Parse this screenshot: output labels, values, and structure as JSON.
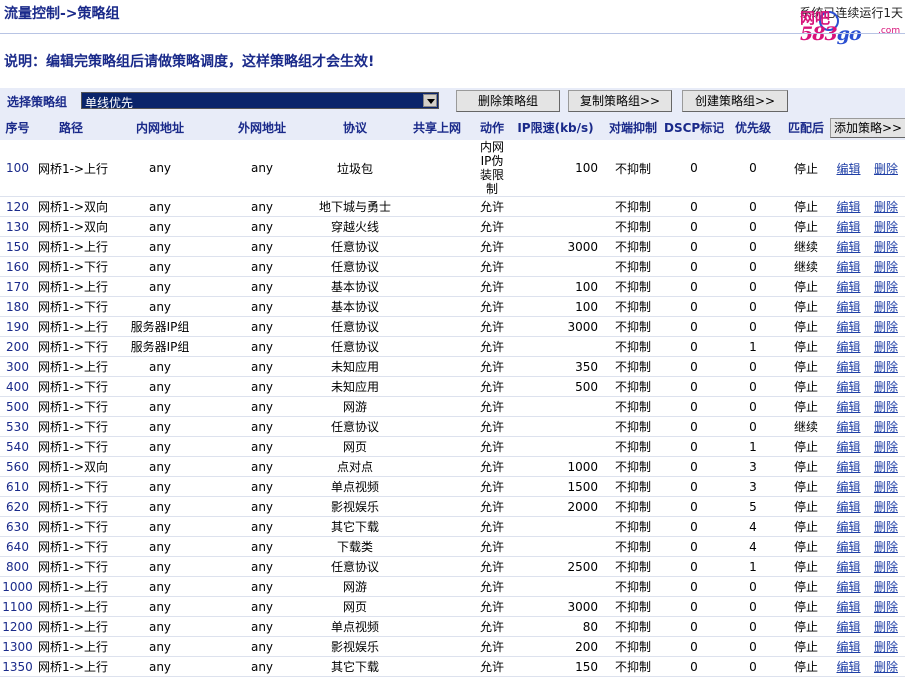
{
  "header": {
    "title": "流量控制->策略组",
    "right_text": "系统已连续运行1天"
  },
  "logo": {
    "line1": "网吧",
    "line2a": "583",
    "line2b": "go",
    "line3": ".com"
  },
  "note": "说明：编辑完策略组后请做策略调度，这样策略组才会生效!",
  "select": {
    "label": "选择策略组",
    "value": "单线优先",
    "delete_label": "删除策略组",
    "copy_label": "复制策略组>>",
    "create_label": "创建策略组>>"
  },
  "columns": [
    "序号",
    "路径",
    "内网地址",
    "外网地址",
    "协议",
    "共享上网",
    "动作",
    "IP限速(kb/s)",
    "对端抑制",
    "DSCP标记",
    "优先级",
    "匹配后"
  ],
  "add_label": "添加策略>>",
  "edit_label": "编辑",
  "delete_label": "删除",
  "rows": [
    [
      "100",
      "网桥1->上行",
      "any",
      "any",
      "垃圾包",
      "",
      "内网IP伪装限制",
      "100",
      "不抑制",
      "0",
      "0",
      "停止"
    ],
    [
      "120",
      "网桥1->双向",
      "any",
      "any",
      "地下城与勇士",
      "",
      "允许",
      "",
      "不抑制",
      "0",
      "0",
      "停止"
    ],
    [
      "130",
      "网桥1->双向",
      "any",
      "any",
      "穿越火线",
      "",
      "允许",
      "",
      "不抑制",
      "0",
      "0",
      "停止"
    ],
    [
      "150",
      "网桥1->上行",
      "any",
      "any",
      "任意协议",
      "",
      "允许",
      "3000",
      "不抑制",
      "0",
      "0",
      "继续"
    ],
    [
      "160",
      "网桥1->下行",
      "any",
      "any",
      "任意协议",
      "",
      "允许",
      "",
      "不抑制",
      "0",
      "0",
      "继续"
    ],
    [
      "170",
      "网桥1->上行",
      "any",
      "any",
      "基本协议",
      "",
      "允许",
      "100",
      "不抑制",
      "0",
      "0",
      "停止"
    ],
    [
      "180",
      "网桥1->下行",
      "any",
      "any",
      "基本协议",
      "",
      "允许",
      "100",
      "不抑制",
      "0",
      "0",
      "停止"
    ],
    [
      "190",
      "网桥1->上行",
      "服务器IP组",
      "any",
      "任意协议",
      "",
      "允许",
      "3000",
      "不抑制",
      "0",
      "0",
      "停止"
    ],
    [
      "200",
      "网桥1->下行",
      "服务器IP组",
      "any",
      "任意协议",
      "",
      "允许",
      "",
      "不抑制",
      "0",
      "1",
      "停止"
    ],
    [
      "300",
      "网桥1->上行",
      "any",
      "any",
      "未知应用",
      "",
      "允许",
      "350",
      "不抑制",
      "0",
      "0",
      "停止"
    ],
    [
      "400",
      "网桥1->下行",
      "any",
      "any",
      "未知应用",
      "",
      "允许",
      "500",
      "不抑制",
      "0",
      "0",
      "停止"
    ],
    [
      "500",
      "网桥1->下行",
      "any",
      "any",
      "网游",
      "",
      "允许",
      "",
      "不抑制",
      "0",
      "0",
      "停止"
    ],
    [
      "530",
      "网桥1->下行",
      "any",
      "any",
      "任意协议",
      "",
      "允许",
      "",
      "不抑制",
      "0",
      "0",
      "继续"
    ],
    [
      "540",
      "网桥1->下行",
      "any",
      "any",
      "网页",
      "",
      "允许",
      "",
      "不抑制",
      "0",
      "1",
      "停止"
    ],
    [
      "560",
      "网桥1->双向",
      "any",
      "any",
      "点对点",
      "",
      "允许",
      "1000",
      "不抑制",
      "0",
      "3",
      "停止"
    ],
    [
      "610",
      "网桥1->下行",
      "any",
      "any",
      "单点视频",
      "",
      "允许",
      "1500",
      "不抑制",
      "0",
      "3",
      "停止"
    ],
    [
      "620",
      "网桥1->下行",
      "any",
      "any",
      "影视娱乐",
      "",
      "允许",
      "2000",
      "不抑制",
      "0",
      "5",
      "停止"
    ],
    [
      "630",
      "网桥1->下行",
      "any",
      "any",
      "其它下载",
      "",
      "允许",
      "",
      "不抑制",
      "0",
      "4",
      "停止"
    ],
    [
      "640",
      "网桥1->下行",
      "any",
      "any",
      "下载类",
      "",
      "允许",
      "",
      "不抑制",
      "0",
      "4",
      "停止"
    ],
    [
      "800",
      "网桥1->下行",
      "any",
      "any",
      "任意协议",
      "",
      "允许",
      "2500",
      "不抑制",
      "0",
      "1",
      "停止"
    ],
    [
      "1000",
      "网桥1->上行",
      "any",
      "any",
      "网游",
      "",
      "允许",
      "",
      "不抑制",
      "0",
      "0",
      "停止"
    ],
    [
      "1100",
      "网桥1->上行",
      "any",
      "any",
      "网页",
      "",
      "允许",
      "3000",
      "不抑制",
      "0",
      "0",
      "停止"
    ],
    [
      "1200",
      "网桥1->上行",
      "any",
      "any",
      "单点视频",
      "",
      "允许",
      "80",
      "不抑制",
      "0",
      "0",
      "停止"
    ],
    [
      "1300",
      "网桥1->上行",
      "any",
      "any",
      "影视娱乐",
      "",
      "允许",
      "200",
      "不抑制",
      "0",
      "0",
      "停止"
    ],
    [
      "1350",
      "网桥1->上行",
      "any",
      "any",
      "其它下载",
      "",
      "允许",
      "150",
      "不抑制",
      "0",
      "0",
      "停止"
    ]
  ],
  "colors": {
    "header_bg": "#e8ecf8",
    "title": "#1a2a8a",
    "link": "#1f3fa6",
    "select_bg": "#0a246a"
  }
}
